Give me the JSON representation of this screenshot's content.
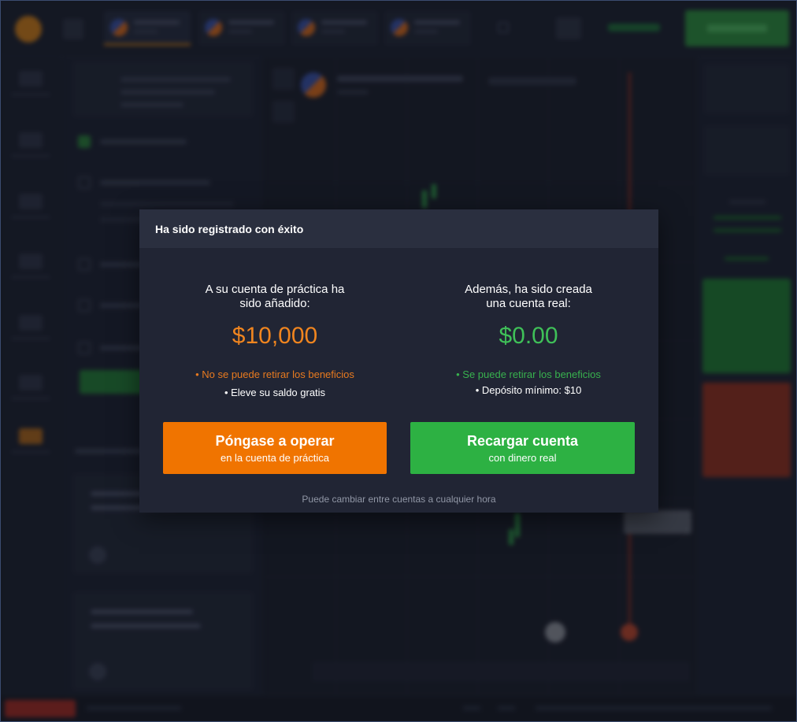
{
  "modal": {
    "title": "Ha sido registrado con éxito",
    "practice": {
      "heading_line1": "A su cuenta de práctica ha",
      "heading_line2": "sido añadido:",
      "amount": "$10,000",
      "note": "• No se puede retirar los beneficios",
      "detail": "• Eleve su saldo gratis",
      "button_main": "Póngase a operar",
      "button_sub": "en la cuenta de práctica"
    },
    "real": {
      "heading_line1": "Además, ha sido creada",
      "heading_line2": "una cuenta real:",
      "amount": "$0.00",
      "note": "• Se puede retirar los beneficios",
      "detail": "• Depósito mínimo:  $10",
      "button_main": "Recargar cuenta",
      "button_sub": "con dinero real"
    },
    "footnote": "Puede cambiar entre cuentas a cualquier hora"
  },
  "colors": {
    "practice_accent": "#f07400",
    "real_accent": "#2db143",
    "modal_bg": "#212534",
    "modal_header_bg": "#2a2f3f"
  },
  "icons": [
    "logo-icon",
    "menu-icon",
    "flag-icon",
    "plus-icon",
    "deposit-icon"
  ]
}
